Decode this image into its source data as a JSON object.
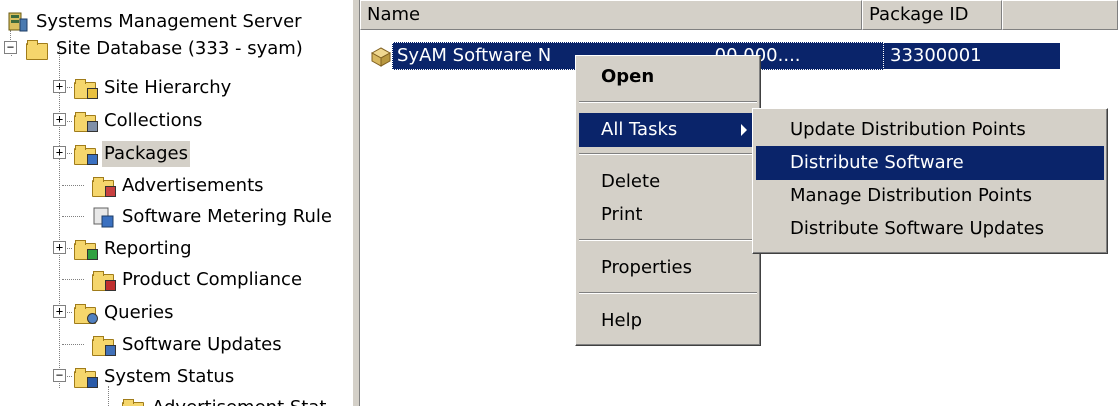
{
  "tree": {
    "root": "Systems Management Server",
    "site_db": "Site Database (333 - syam)",
    "items": [
      {
        "label": "Site Hierarchy"
      },
      {
        "label": "Collections"
      },
      {
        "label": "Packages"
      },
      {
        "label": "Advertisements"
      },
      {
        "label": "Software Metering Rule"
      },
      {
        "label": "Reporting"
      },
      {
        "label": "Product Compliance"
      },
      {
        "label": "Queries"
      },
      {
        "label": "Software Updates"
      },
      {
        "label": "System Status"
      },
      {
        "label": "Advertisement Stat"
      }
    ]
  },
  "list": {
    "columns": {
      "name": "Name",
      "package_id": "Package ID"
    },
    "row": {
      "name": "SyAM Software N",
      "name_tail": "00.000....",
      "package_id": "33300001"
    }
  },
  "context_menu": {
    "open": "Open",
    "all_tasks": "All Tasks",
    "delete": "Delete",
    "print": "Print",
    "properties": "Properties",
    "help": "Help"
  },
  "submenu": {
    "update_dp": "Update Distribution Points",
    "distribute": "Distribute Software",
    "manage_dp": "Manage Distribution Points",
    "distribute_updates": "Distribute Software Updates"
  },
  "colors": {
    "selection": "#0a246a",
    "menu_face": "#d4d0c8"
  }
}
